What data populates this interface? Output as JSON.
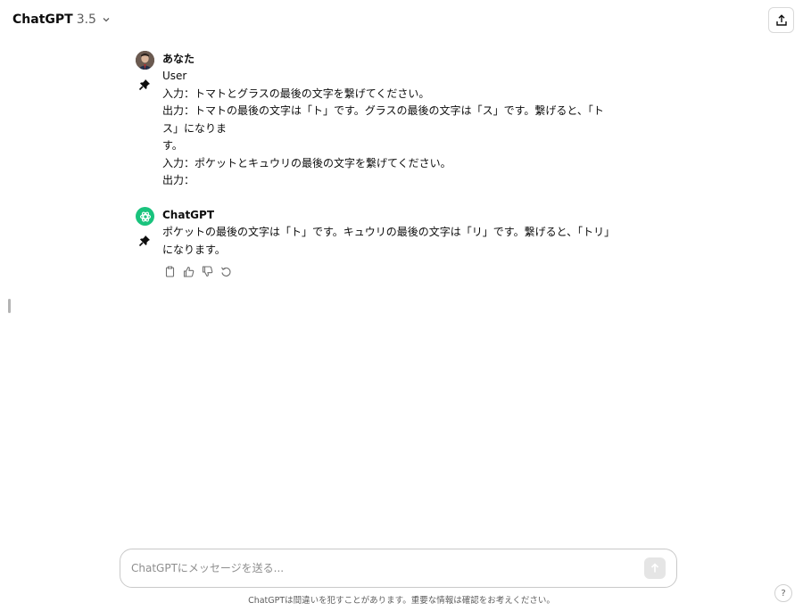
{
  "header": {
    "model_name": "ChatGPT",
    "model_version": "3.5"
  },
  "icons": {
    "chevron": "chevron-down-icon",
    "share": "share-icon",
    "pin": "pin-icon",
    "copy": "copy-icon",
    "thumbs_up": "thumbs-up-icon",
    "thumbs_down": "thumbs-down-icon",
    "regenerate": "regenerate-icon",
    "send": "arrow-up-icon",
    "help": "question-icon"
  },
  "conversation": {
    "user_message": {
      "author": "あなた",
      "lines": [
        "User",
        "入力：トマトとグラスの最後の文字を繋げてください。",
        "出力：トマトの最後の文字は「ト」です。グラスの最後の文字は「ス」です。繋げると、「トス」になりま",
        "す。",
        "入力：ポケットとキュウリの最後の文字を繋げてください。",
        "出力："
      ]
    },
    "assistant_message": {
      "author": "ChatGPT",
      "text": "ポケットの最後の文字は「ト」です。キュウリの最後の文字は「リ」です。繋げると、「トリ」になります。"
    }
  },
  "composer": {
    "placeholder": "ChatGPTにメッセージを送る..."
  },
  "footer": {
    "disclaimer": "ChatGPTは間違いを犯すことがあります。重要な情報は確認をお考えください。",
    "help_label": "?"
  },
  "colors": {
    "accent": "#19c37d",
    "text": "#0d0d0d",
    "muted": "#5d5d5d"
  }
}
